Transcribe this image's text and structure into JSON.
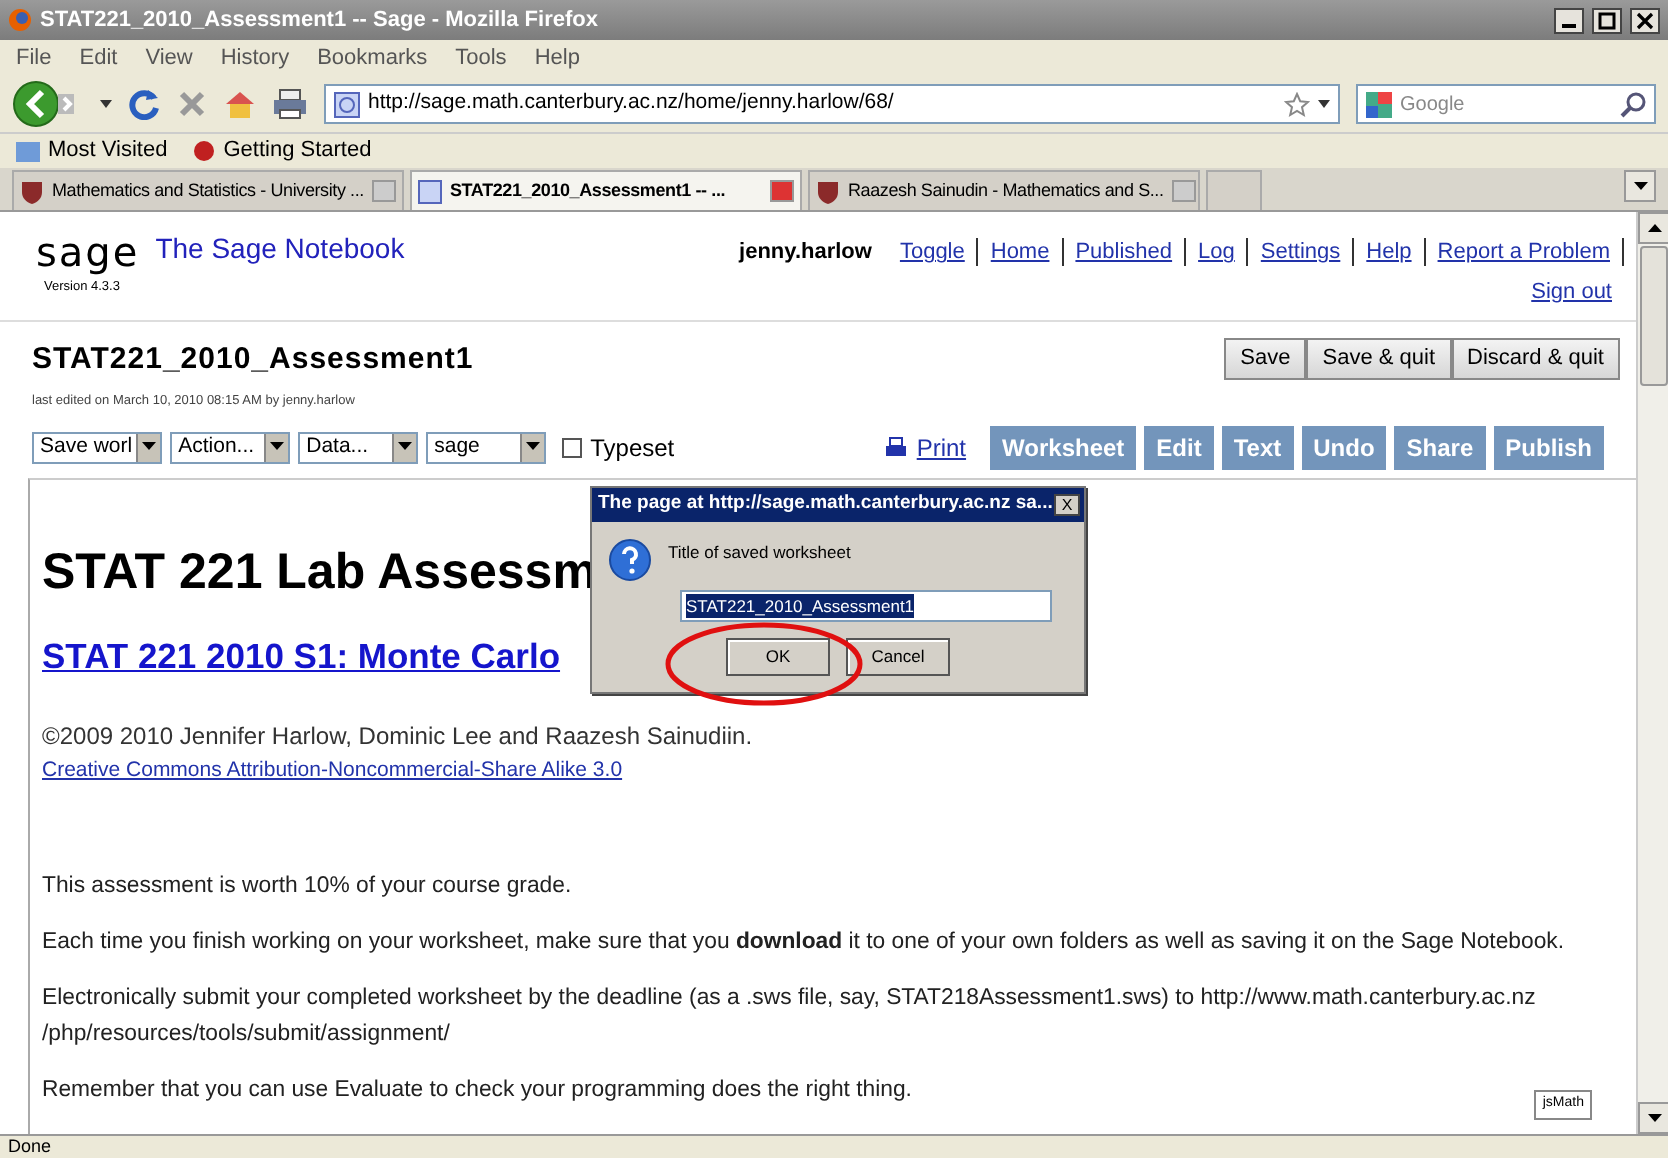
{
  "window": {
    "title": "STAT221_2010_Assessment1 -- Sage - Mozilla Firefox"
  },
  "menu": [
    "File",
    "Edit",
    "View",
    "History",
    "Bookmarks",
    "Tools",
    "Help"
  ],
  "navbar": {
    "url": "http://sage.math.canterbury.ac.nz/home/jenny.harlow/68/",
    "search_placeholder": "Google"
  },
  "bookmarks": [
    "Most Visited",
    "Getting Started"
  ],
  "tabs": [
    {
      "label": "Mathematics and Statistics - University ...",
      "selected": false
    },
    {
      "label": "STAT221_2010_Assessment1 -- ...",
      "selected": true
    },
    {
      "label": "Raazesh Sainudin - Mathematics and S...",
      "selected": false
    }
  ],
  "sage": {
    "logo": "sage",
    "name": "The Sage Notebook",
    "version": "Version 4.3.3",
    "user": "jenny.harlow",
    "links": [
      "Toggle",
      "Home",
      "Published",
      "Log",
      "Settings",
      "Help",
      "Report a Problem"
    ],
    "sign_out": "Sign out"
  },
  "worksheet": {
    "title": "STAT221_2010_Assessment1",
    "last_edited": "last edited on March 10, 2010 08:15 AM by jenny.harlow",
    "actions": [
      "Save",
      "Save & quit",
      "Discard & quit"
    ],
    "selects": [
      "Save worl",
      "Action...",
      "Data...",
      "sage"
    ],
    "typeset": {
      "label": "Typeset",
      "checked": false
    },
    "print": "Print",
    "modes": [
      "Worksheet",
      "Edit",
      "Text",
      "Undo",
      "Share",
      "Publish"
    ]
  },
  "body": {
    "heading": "STAT 221 Lab Assessm",
    "link": "STAT 221 2010 S1: Monte Carlo",
    "copyright": "©2009 2010 Jennifer Harlow, Dominic Lee and Raazesh Sainudiin.",
    "license": "Creative Commons Attribution-Noncommercial-Share Alike 3.0",
    "paragraphs": [
      "This assessment is worth 10% of your course grade.",
      "Each time you finish working on your worksheet, make sure that you **download** it to one of your own folders as well as saving it on the Sage Notebook.",
      "Electronically submit your completed worksheet by the deadline (as a .sws file, say, STAT218Assessment1.sws) to http://www.math.canterbury.ac.nz\n/php/resources/tools/submit/assignment/",
      "Remember that you can use Evaluate to check your programming does the right thing."
    ],
    "jsmath": "jsMath"
  },
  "dialog": {
    "title": "The page at http://sage.math.canterbury.ac.nz sa...",
    "close": "X",
    "prompt": "Title of saved worksheet",
    "value": "STAT221_2010_Assessment1",
    "buttons": [
      "OK",
      "Cancel"
    ]
  },
  "status": "Done"
}
